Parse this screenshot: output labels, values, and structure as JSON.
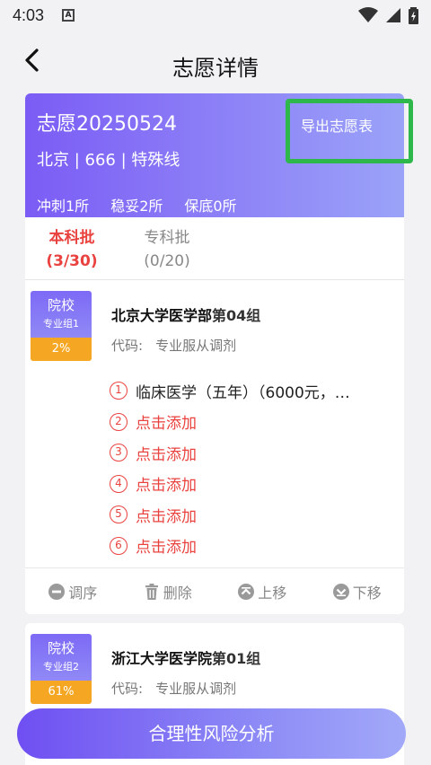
{
  "status_bar": {
    "time": "4:03",
    "notif_glyph": "A"
  },
  "nav": {
    "title": "志愿详情"
  },
  "summary": {
    "title": "志愿20250524",
    "info": "北京 | 666 | 特殊线",
    "stats": [
      "冲刺1所",
      "稳妥2所",
      "保底0所"
    ],
    "export_label": "导出志愿表"
  },
  "tabs": [
    {
      "label": "本科批",
      "count": "(3/30)",
      "active": true
    },
    {
      "label": "专科批",
      "count": "(0/20)",
      "active": false
    }
  ],
  "schools": [
    {
      "badge_line1": "院校",
      "badge_line2": "专业组1",
      "percent": "2%",
      "name": "北京大学医学部",
      "group": "第04组",
      "code_label": "代码:",
      "code_value": "专业服从调剂",
      "majors": [
        {
          "num": "1",
          "name": "临床医学（五年）（6000元，…"
        },
        {
          "num": "2",
          "name": "点击添加"
        },
        {
          "num": "3",
          "name": "点击添加"
        },
        {
          "num": "4",
          "name": "点击添加"
        },
        {
          "num": "5",
          "name": "点击添加"
        },
        {
          "num": "6",
          "name": "点击添加"
        }
      ],
      "actions": [
        "调序",
        "删除",
        "上移",
        "下移"
      ]
    },
    {
      "badge_line1": "院校",
      "badge_line2": "专业组2",
      "percent": "61%",
      "name": "浙江大学医学院",
      "group": "第01组",
      "code_label": "代码:",
      "code_value": "专业服从调剂"
    }
  ],
  "bottom_button": {
    "label": "合理性风险分析"
  },
  "colors": {
    "accent": "#7b5cf5",
    "red": "#e9423f",
    "orange": "#f5a623",
    "green": "#2eb84b"
  }
}
